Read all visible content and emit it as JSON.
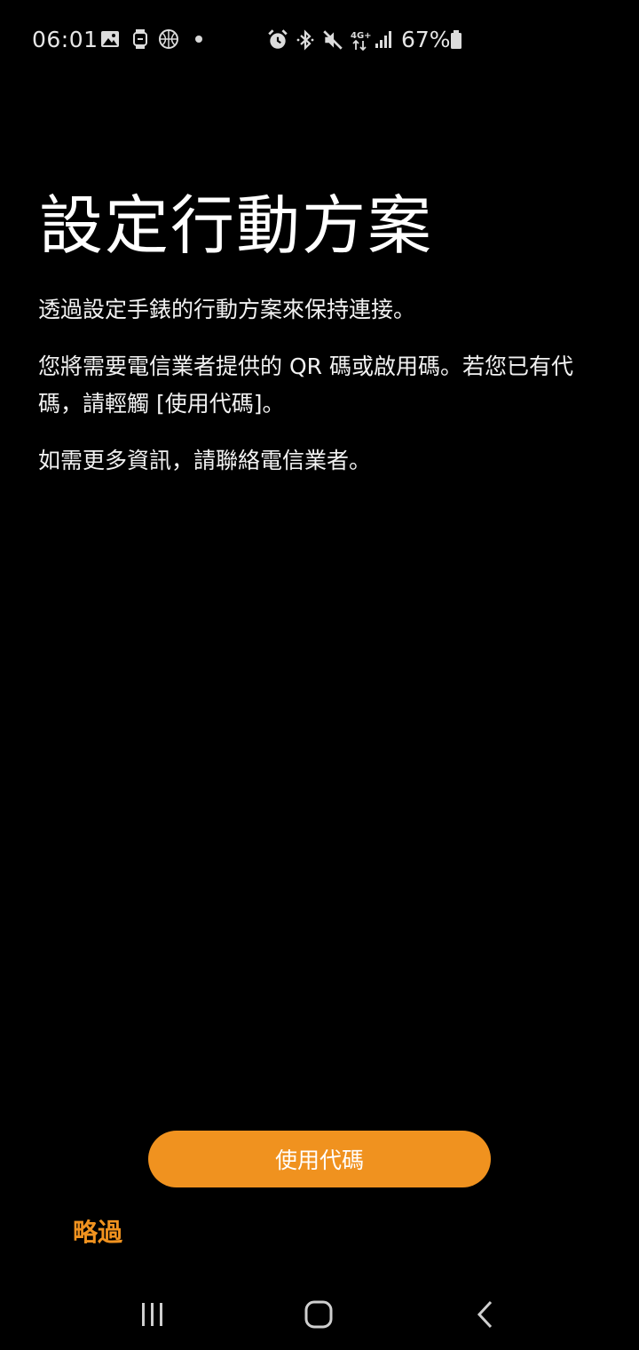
{
  "status_bar": {
    "time": "06:01",
    "battery_percent": "67%",
    "icons": [
      "image-icon",
      "watch-icon",
      "basketball-icon",
      "alarm-icon",
      "bluetooth-icon",
      "mute-icon",
      "4g-plus-icon",
      "signal-icon",
      "battery-icon"
    ]
  },
  "content": {
    "title": "設定行動方案",
    "paragraph_1": "透過設定手錶的行動方案來保持連接。",
    "paragraph_2": "您將需要電信業者提供的 QR 碼或啟用碼。若您已有代碼，請輕觸 [使用代碼]。",
    "paragraph_3": "如需更多資訊，請聯絡電信業者。"
  },
  "actions": {
    "use_code_label": "使用代碼",
    "skip_label": "略過",
    "accent_color": "#f0921f"
  },
  "nav_bar": {
    "icons": [
      "recent-apps-icon",
      "home-icon",
      "back-icon"
    ]
  }
}
